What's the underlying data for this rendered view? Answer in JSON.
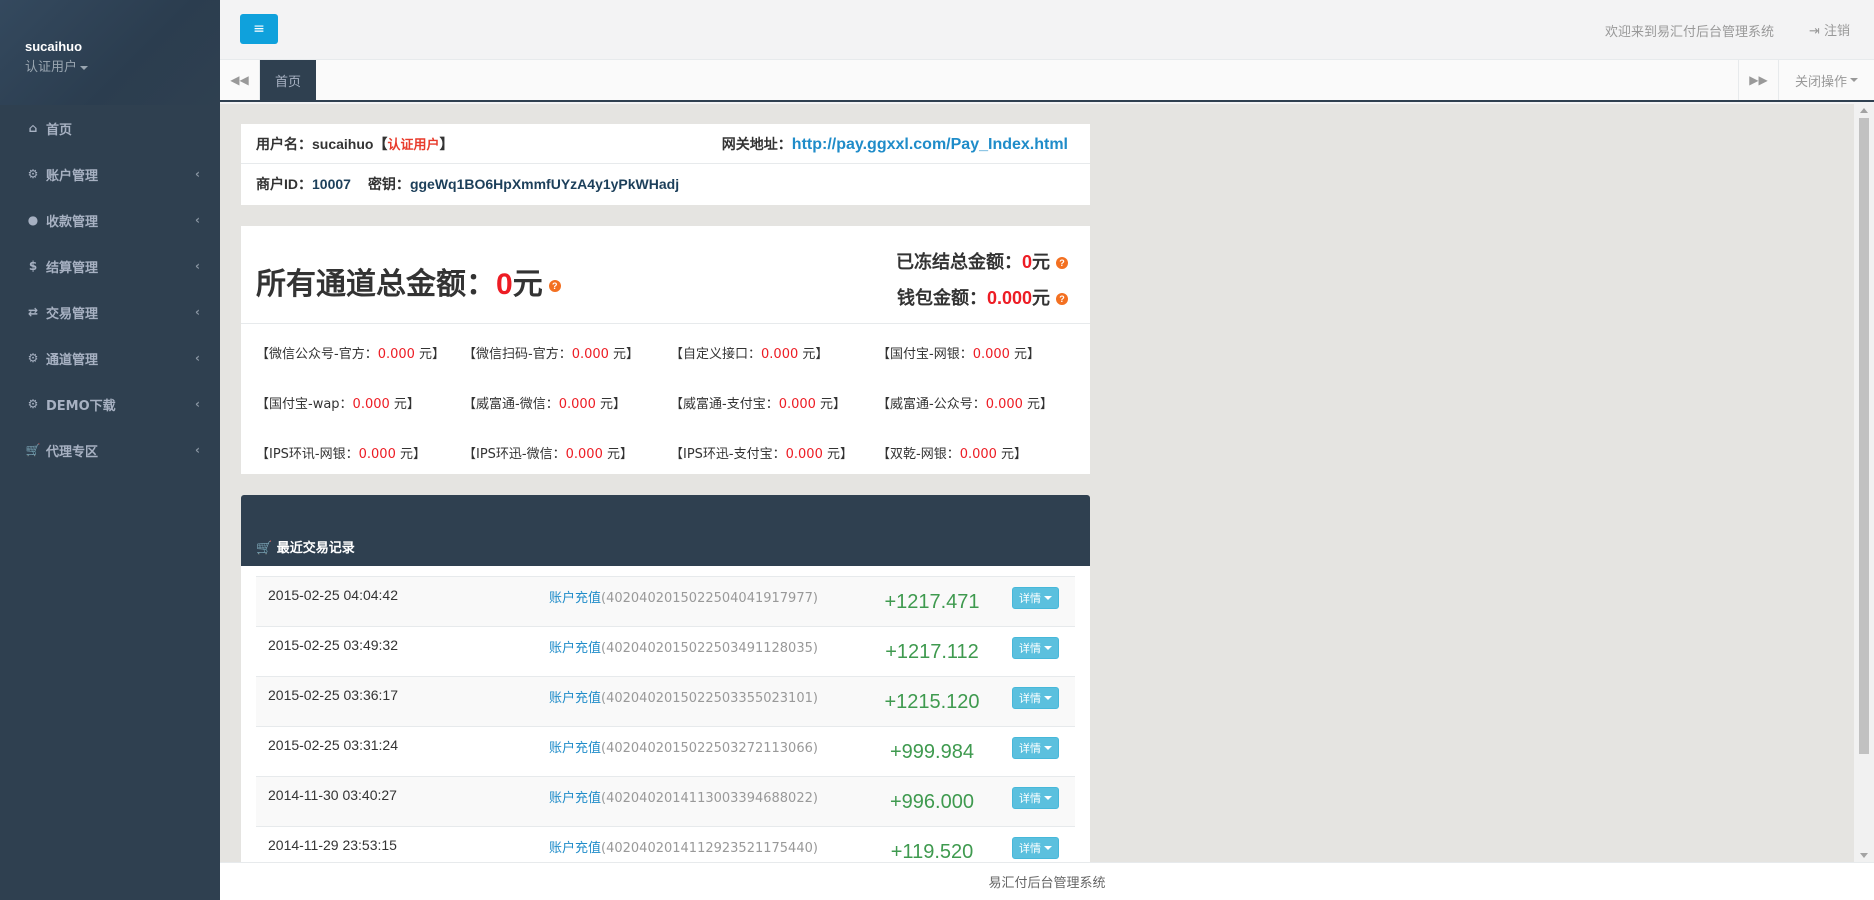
{
  "sidebar": {
    "username": "sucaihuo",
    "role": "认证用户",
    "items": [
      {
        "label": "首页",
        "icon": "home-icon",
        "glyph": "⌂",
        "has_arrow": false
      },
      {
        "label": "账户管理",
        "icon": "account-icon",
        "glyph": "⚙",
        "has_arrow": true
      },
      {
        "label": "收款管理",
        "icon": "user-icon",
        "glyph": "●",
        "has_arrow": true
      },
      {
        "label": "结算管理",
        "icon": "dollar-icon",
        "glyph": "$",
        "has_arrow": true
      },
      {
        "label": "交易管理",
        "icon": "exchange-icon",
        "glyph": "⇄",
        "has_arrow": true
      },
      {
        "label": "通道管理",
        "icon": "gear-icon",
        "glyph": "⚙",
        "has_arrow": true
      },
      {
        "label": "DEMO下载",
        "icon": "gear-icon",
        "glyph": "⚙",
        "has_arrow": true
      },
      {
        "label": "代理专区",
        "icon": "cart-icon",
        "glyph": "🛒",
        "has_arrow": true
      }
    ]
  },
  "topbar": {
    "menu_glyph": "≡",
    "welcome": "欢迎来到易汇付后台管理系统",
    "logout": "注销",
    "logout_glyph": "⇥"
  },
  "tabs": {
    "left_glyph": "◀◀",
    "home": "首页",
    "right_glyph": "▶▶",
    "close_ops": "关闭操作"
  },
  "account": {
    "username_label": "用户名：",
    "username": "sucaihuo",
    "bracket_open": "【",
    "cert": "认证用户",
    "bracket_close": "】",
    "gateway_label": "网关地址：",
    "gateway_url": "http://pay.ggxxl.com/Pay_Index.html",
    "merchant_label": "商户ID：",
    "merchant_id": "10007",
    "key_label": "密钥：",
    "key": "ggeWq1BO6HpXmmfUYzA4y1yPkWHadj"
  },
  "summary": {
    "total_label": "所有通道总金额：",
    "total_value": "0",
    "total_unit": "元",
    "frozen_label": "已冻结总金额：",
    "frozen_value": "0",
    "frozen_unit": "元",
    "wallet_label": "钱包金额：",
    "wallet_value": "0.000",
    "wallet_unit": "元",
    "help_glyph": "?"
  },
  "channels": [
    {
      "name": "【微信公众号-官方：",
      "amount": "0.000",
      "unit": " 元】"
    },
    {
      "name": "【微信扫码-官方：",
      "amount": "0.000",
      "unit": " 元】"
    },
    {
      "name": "【自定义接口：",
      "amount": "0.000",
      "unit": " 元】"
    },
    {
      "name": "【国付宝-网银：",
      "amount": "0.000",
      "unit": " 元】"
    },
    {
      "name": "【国付宝-wap：",
      "amount": "0.000",
      "unit": " 元】"
    },
    {
      "name": "【威富通-微信：",
      "amount": "0.000",
      "unit": " 元】"
    },
    {
      "name": "【威富通-支付宝：",
      "amount": "0.000",
      "unit": " 元】"
    },
    {
      "name": "【威富通-公众号：",
      "amount": "0.000",
      "unit": " 元】"
    },
    {
      "name": "【IPS环讯-网银：",
      "amount": "0.000",
      "unit": " 元】"
    },
    {
      "name": "【IPS环迅-微信：",
      "amount": "0.000",
      "unit": " 元】"
    },
    {
      "name": "【IPS环迅-支付宝：",
      "amount": "0.000",
      "unit": " 元】"
    },
    {
      "name": "【双乾-网银：",
      "amount": "0.000",
      "unit": " 元】"
    }
  ],
  "transactions": {
    "title": "最近交易记录",
    "detail_label": "详情",
    "rows": [
      {
        "date": "2015-02-25 04:04:42",
        "type": "账户充值",
        "id": "(4020402015022504041917977)",
        "amount": "+1217.471"
      },
      {
        "date": "2015-02-25 03:49:32",
        "type": "账户充值",
        "id": "(4020402015022503491128035)",
        "amount": "+1217.112"
      },
      {
        "date": "2015-02-25 03:36:17",
        "type": "账户充值",
        "id": "(4020402015022503355023101)",
        "amount": "+1215.120"
      },
      {
        "date": "2015-02-25 03:31:24",
        "type": "账户充值",
        "id": "(4020402015022503272113066)",
        "amount": "+999.984"
      },
      {
        "date": "2014-11-30 03:40:27",
        "type": "账户充值",
        "id": "(4020402014113003394688022)",
        "amount": "+996.000"
      },
      {
        "date": "2014-11-29 23:53:15",
        "type": "账户充值",
        "id": "(4020402014112923521175440)",
        "amount": "+119.520"
      }
    ]
  },
  "footer": {
    "text": "易汇付后台管理系统"
  }
}
